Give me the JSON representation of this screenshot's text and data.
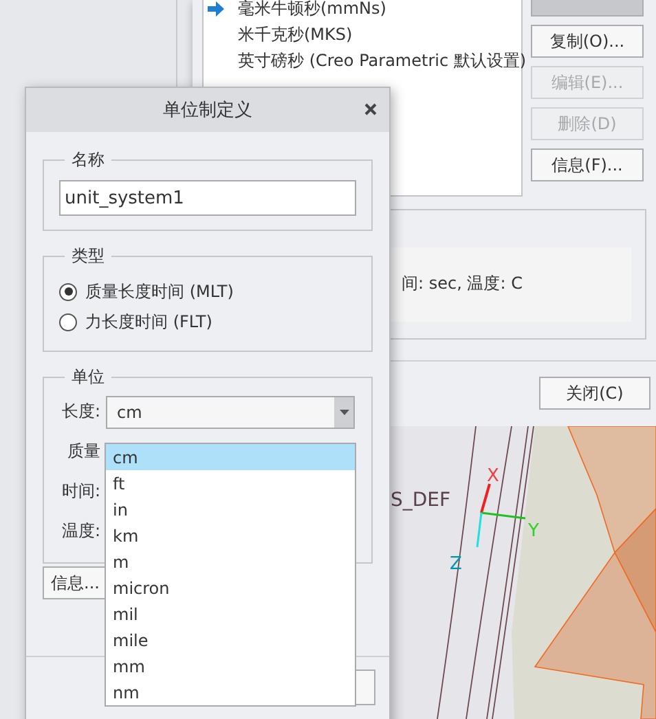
{
  "manager": {
    "list_items": [
      {
        "label": "毫米牛顿秒(mmNs)",
        "current": true
      },
      {
        "label": "米千克秒(MKS)",
        "current": false
      },
      {
        "label": "英寸磅秒 (Creo Parametric 默认设置)",
        "current": false
      }
    ],
    "buttons": [
      {
        "disabled": false,
        "pressed": true
      },
      {
        "label": "复制(O)...",
        "disabled": false,
        "pressed": false
      },
      {
        "label": "编辑(E)...",
        "disabled": true,
        "pressed": false
      },
      {
        "label": "删除(D)",
        "disabled": true,
        "pressed": false
      },
      {
        "label": "信息(F)...",
        "disabled": false,
        "pressed": false
      }
    ],
    "description": "间: sec, 温度: C",
    "close_button": "关闭(C)"
  },
  "dialog": {
    "title": "单位制定义",
    "name_group": {
      "legend": "名称",
      "value": "unit_system1"
    },
    "type_group": {
      "legend": "类型",
      "options": [
        {
          "label": "质量长度时间 (MLT)",
          "selected": true
        },
        {
          "label": "力长度时间 (FLT)",
          "selected": false
        }
      ]
    },
    "units_group": {
      "legend": "单位",
      "rows": [
        {
          "label": "长度:",
          "value": "cm"
        },
        {
          "label": "质量"
        },
        {
          "label": "时间:"
        },
        {
          "label": "温度:"
        }
      ]
    },
    "dropdown": {
      "options": [
        {
          "label": "cm",
          "selected": true
        },
        {
          "label": "ft",
          "selected": false
        },
        {
          "label": "in",
          "selected": false
        },
        {
          "label": "km",
          "selected": false
        },
        {
          "label": "m",
          "selected": false
        },
        {
          "label": "micron",
          "selected": false
        },
        {
          "label": "mil",
          "selected": false
        },
        {
          "label": "mile",
          "selected": false
        },
        {
          "label": "mm",
          "selected": false
        },
        {
          "label": "nm",
          "selected": false
        }
      ]
    },
    "info_button": "信息..."
  },
  "viewport": {
    "datum_label": "S_DEF",
    "axes": [
      "X",
      "Y",
      "Z"
    ]
  }
}
